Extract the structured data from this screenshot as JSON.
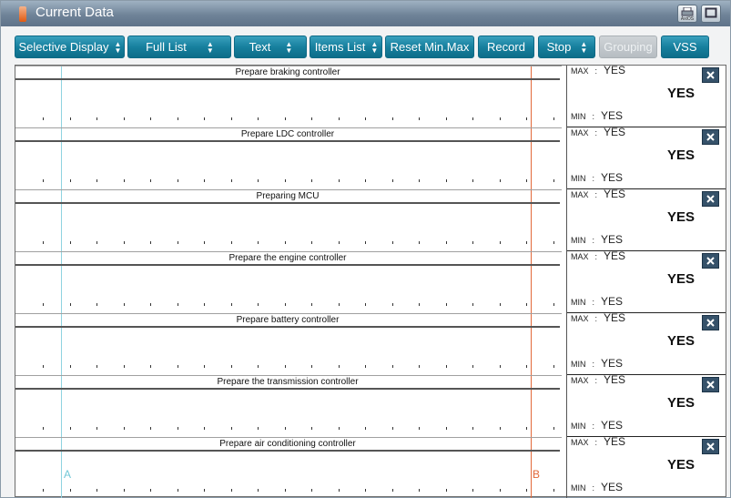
{
  "window": {
    "title": "Current Data"
  },
  "titlebar": {
    "print_caption": "AxiOS"
  },
  "toolbar": {
    "buttons": [
      {
        "label": "Selective Display",
        "dropdown": true,
        "enabled": true
      },
      {
        "label": "Full List",
        "dropdown": true,
        "enabled": true
      },
      {
        "label": "Text",
        "dropdown": true,
        "enabled": true
      },
      {
        "label": "Items List",
        "dropdown": true,
        "enabled": true
      },
      {
        "label": "Reset Min.Max",
        "dropdown": false,
        "enabled": true
      },
      {
        "label": "Record",
        "dropdown": false,
        "enabled": true
      },
      {
        "label": "Stop",
        "dropdown": true,
        "enabled": true
      },
      {
        "label": "Grouping",
        "dropdown": false,
        "enabled": false
      },
      {
        "label": "VSS",
        "dropdown": false,
        "enabled": true
      }
    ]
  },
  "labels": {
    "max": "MAX",
    "min": "MIN",
    "colon": ":"
  },
  "cursors": {
    "a": "A",
    "b": "B"
  },
  "rows": [
    {
      "label": "Prepare braking controller",
      "max": "YES",
      "current": "YES",
      "min": "YES"
    },
    {
      "label": "Prepare LDC controller",
      "max": "YES",
      "current": "YES",
      "min": "YES"
    },
    {
      "label": "Preparing MCU",
      "max": "YES",
      "current": "YES",
      "min": "YES"
    },
    {
      "label": "Prepare the engine controller",
      "max": "YES",
      "current": "YES",
      "min": "YES"
    },
    {
      "label": "Prepare battery controller",
      "max": "YES",
      "current": "YES",
      "min": "YES"
    },
    {
      "label": "Prepare the transmission controller",
      "max": "YES",
      "current": "YES",
      "min": "YES"
    },
    {
      "label": "Prepare air conditioning controller",
      "max": "YES",
      "current": "YES",
      "min": "YES"
    }
  ],
  "colors": {
    "button": "#17809e",
    "cursor_a": "#8fd3e0",
    "cursor_b": "#e2693b",
    "close": "#36526a"
  }
}
